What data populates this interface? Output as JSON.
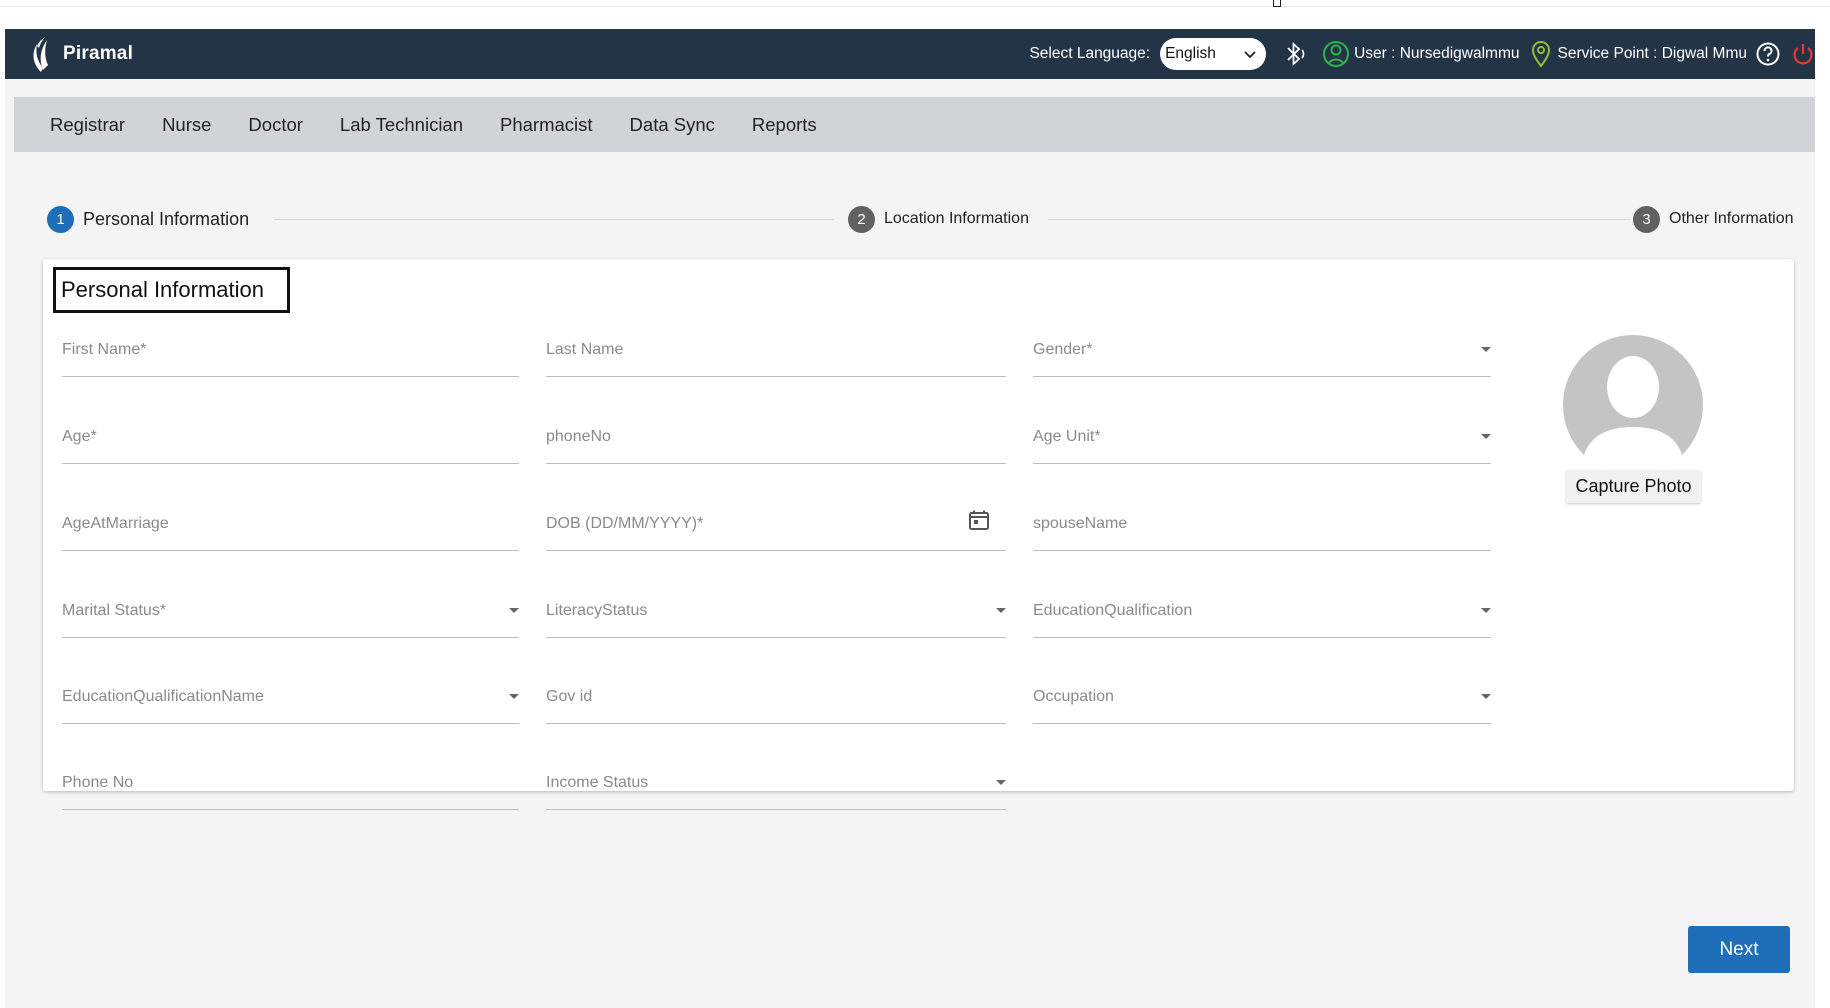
{
  "header": {
    "brand": "Piramal",
    "select_language_label": "Select Language:",
    "language_value": "English",
    "user_text": "User : Nursedigwalmmu",
    "service_point_text": "Service Point : Digwal Mmu"
  },
  "nav": {
    "items": [
      {
        "label": "Registrar"
      },
      {
        "label": "Nurse"
      },
      {
        "label": "Doctor"
      },
      {
        "label": "Lab Technician"
      },
      {
        "label": "Pharmacist"
      },
      {
        "label": "Data Sync"
      },
      {
        "label": "Reports"
      }
    ]
  },
  "stepper": {
    "steps": [
      {
        "number": "1",
        "label": "Personal Information",
        "state": "active"
      },
      {
        "number": "2",
        "label": "Location Information",
        "state": "inactive"
      },
      {
        "number": "3",
        "label": "Other Information",
        "state": "inactive"
      }
    ]
  },
  "form": {
    "title": "Personal Information",
    "fields": {
      "first_name": "First Name*",
      "last_name": "Last Name",
      "gender": "Gender*",
      "age": "Age*",
      "phone_no_camel": "phoneNo",
      "age_unit": "Age Unit*",
      "age_at_marriage": "AgeAtMarriage",
      "dob": "DOB (DD/MM/YYYY)*",
      "spouse_name": "spouseName",
      "marital_status": "Marital Status*",
      "literacy_status": "LiteracyStatus",
      "education_qualification": "EducationQualification",
      "education_qualification_name": "EducationQualificationName",
      "gov_id": "Gov id",
      "occupation": "Occupation",
      "phone_no": "Phone No",
      "income_status": "Income Status"
    },
    "capture_photo_label": "Capture Photo",
    "next_label": "Next"
  },
  "colors": {
    "header_bg": "#243447",
    "nav_bg": "#d0d4d6",
    "accent": "#1e6fb8",
    "step_inactive": "#616161",
    "user_icon": "#2bb24c",
    "pin_icon": "#8fbf3a",
    "power_icon": "#e53935"
  }
}
